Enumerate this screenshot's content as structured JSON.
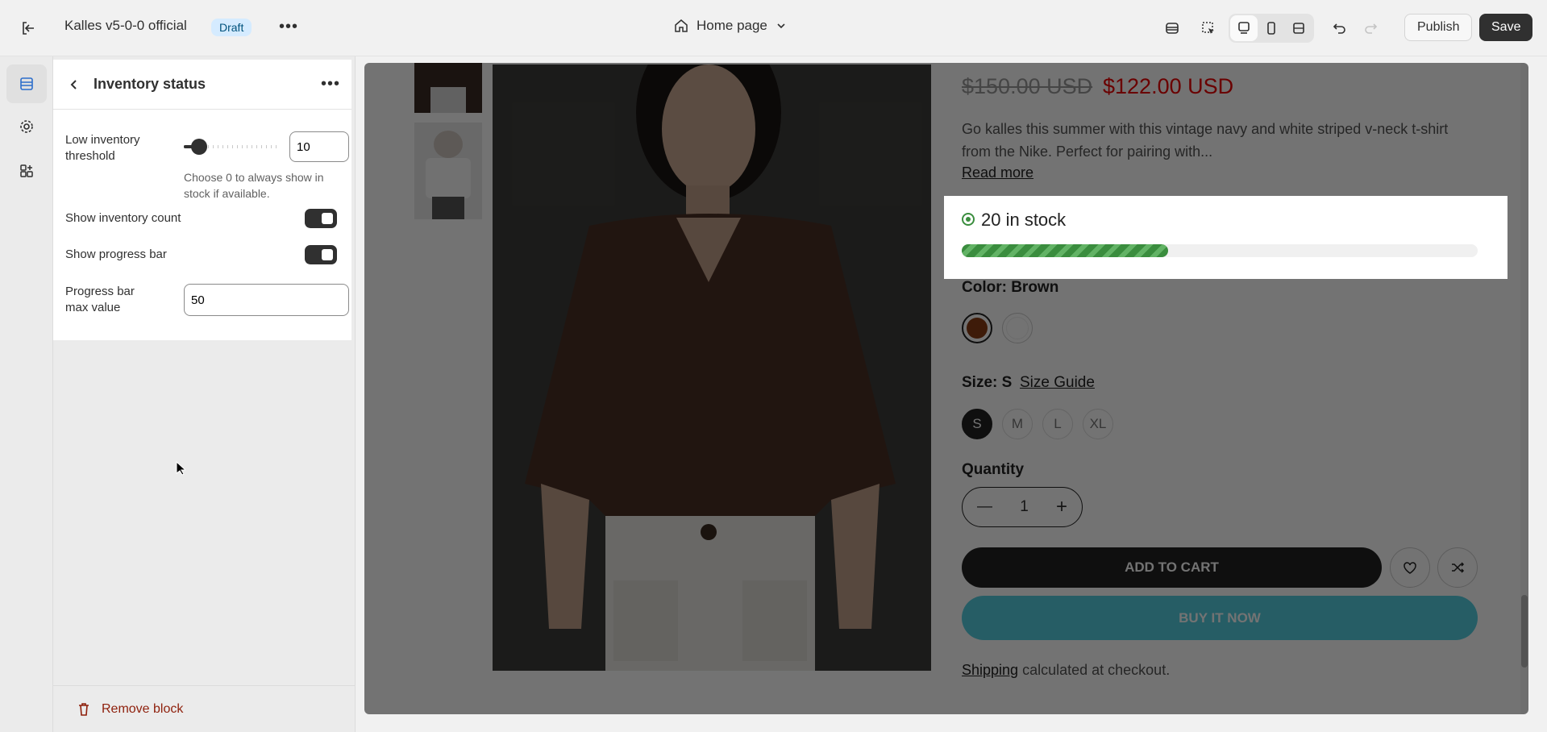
{
  "topbar": {
    "store_name": "Kalles v5-0-0 official",
    "status_badge": "Draft",
    "page_selector": "Home page",
    "publish_label": "Publish",
    "save_label": "Save"
  },
  "panel": {
    "title": "Inventory status",
    "low_threshold_label": "Low inventory threshold",
    "low_threshold_value": "10",
    "low_threshold_help": "Choose 0 to always show in stock if available.",
    "show_count_label": "Show inventory count",
    "show_progress_label": "Show progress bar",
    "max_value_label": "Progress bar max value",
    "max_value": "50",
    "remove_label": "Remove block"
  },
  "product": {
    "compare_price": "$150.00 USD",
    "price": "$122.00 USD",
    "description": "Go kalles this summer with this vintage navy and white striped v-neck t-shirt from the Nike. Perfect for pairing with...",
    "read_more": "Read more",
    "stock_text": "20 in stock",
    "stock_fraction": 0.4,
    "color_label": "Color: Brown",
    "size_label": "Size: S",
    "size_guide": "Size Guide",
    "sizes": [
      "S",
      "M",
      "L",
      "XL"
    ],
    "quantity_label": "Quantity",
    "quantity": "1",
    "add_to_cart": "ADD TO CART",
    "buy_now": "BUY IT NOW",
    "shipping_link": "Shipping",
    "shipping_rest": "calculated at checkout."
  },
  "colors": {
    "accent_dark": "#303030",
    "price_red": "#ec0101",
    "stock_green": "#3a8d3e",
    "buy_blue": "#56cfe1",
    "remove_red": "#8e1f0b"
  }
}
